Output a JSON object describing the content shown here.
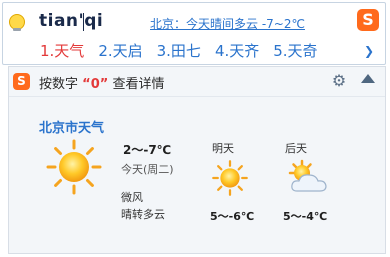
{
  "ime": {
    "pinyin": "tian'qi",
    "weather_hint": "北京：今天晴间多云 -7~2℃",
    "logo_letter": "S",
    "candidates": [
      {
        "label": "1.天气"
      },
      {
        "label": "2.天启"
      },
      {
        "label": "3.田七"
      },
      {
        "label": "4.天齐"
      },
      {
        "label": "5.天奇"
      }
    ],
    "more_icon": "chevron-right-icon"
  },
  "panel": {
    "logo_letter": "S",
    "hint_prefix": "按数字",
    "hint_key": "“0”",
    "hint_suffix": "查看详情",
    "city": "北京市天气",
    "today": {
      "temp": "2～-7℃",
      "day": "今天(周二)",
      "wind": "微风",
      "condition": "晴转多云",
      "icon": "sun-icon"
    },
    "tomorrow": {
      "label": "明天",
      "temp": "5～-6℃",
      "icon": "sun-icon"
    },
    "day_after": {
      "label": "后天",
      "temp": "5～-4℃",
      "icon": "partly-cloudy-icon"
    }
  },
  "colors": {
    "accent_blue": "#2a73cc",
    "candidate_active_red": "#e33939",
    "sogou_orange": "#ff6a1c"
  }
}
